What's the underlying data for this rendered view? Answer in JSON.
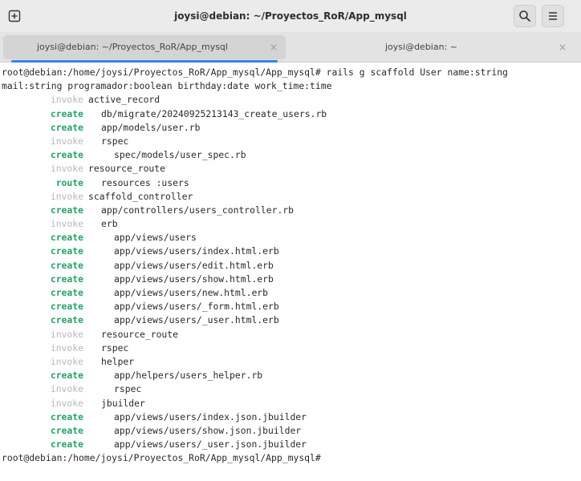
{
  "window": {
    "title": "joysi@debian: ~/Proyectos_RoR/App_mysql"
  },
  "colors": {
    "accent": "#3584e4",
    "create": "#26a269",
    "invoke": "#b8b8b8"
  },
  "tabs": [
    {
      "label": "joysi@debian: ~/Proyectos_RoR/App_mysql",
      "close": "×",
      "active": true
    },
    {
      "label": "joysi@debian: ~",
      "close": "×",
      "active": false
    }
  ],
  "terminal": {
    "command_lines": [
      "root@debian:/home/joysi/Proyectos_RoR/App_mysql/App_mysql# rails g scaffold User name:string",
      "mail:string programador:boolean birthday:date work_time:time"
    ],
    "output": [
      {
        "action": "invoke",
        "path": "active_record",
        "indent": 0
      },
      {
        "action": "create",
        "path": "db/migrate/20240925213143_create_users.rb",
        "indent": 1
      },
      {
        "action": "create",
        "path": "app/models/user.rb",
        "indent": 1
      },
      {
        "action": "invoke",
        "path": "rspec",
        "indent": 1
      },
      {
        "action": "create",
        "path": "spec/models/user_spec.rb",
        "indent": 2
      },
      {
        "action": "invoke",
        "path": "resource_route",
        "indent": 0
      },
      {
        "action": "route",
        "path": "resources :users",
        "indent": 1
      },
      {
        "action": "invoke",
        "path": "scaffold_controller",
        "indent": 0
      },
      {
        "action": "create",
        "path": "app/controllers/users_controller.rb",
        "indent": 1
      },
      {
        "action": "invoke",
        "path": "erb",
        "indent": 1
      },
      {
        "action": "create",
        "path": "app/views/users",
        "indent": 2
      },
      {
        "action": "create",
        "path": "app/views/users/index.html.erb",
        "indent": 2
      },
      {
        "action": "create",
        "path": "app/views/users/edit.html.erb",
        "indent": 2
      },
      {
        "action": "create",
        "path": "app/views/users/show.html.erb",
        "indent": 2
      },
      {
        "action": "create",
        "path": "app/views/users/new.html.erb",
        "indent": 2
      },
      {
        "action": "create",
        "path": "app/views/users/_form.html.erb",
        "indent": 2
      },
      {
        "action": "create",
        "path": "app/views/users/_user.html.erb",
        "indent": 2
      },
      {
        "action": "invoke",
        "path": "resource_route",
        "indent": 1
      },
      {
        "action": "invoke",
        "path": "rspec",
        "indent": 1
      },
      {
        "action": "invoke",
        "path": "helper",
        "indent": 1
      },
      {
        "action": "create",
        "path": "app/helpers/users_helper.rb",
        "indent": 2
      },
      {
        "action": "invoke",
        "path": "rspec",
        "indent": 2
      },
      {
        "action": "invoke",
        "path": "jbuilder",
        "indent": 1
      },
      {
        "action": "create",
        "path": "app/views/users/index.json.jbuilder",
        "indent": 2
      },
      {
        "action": "create",
        "path": "app/views/users/show.json.jbuilder",
        "indent": 2
      },
      {
        "action": "create",
        "path": "app/views/users/_user.json.jbuilder",
        "indent": 2
      }
    ],
    "final_prompt": "root@debian:/home/joysi/Proyectos_RoR/App_mysql/App_mysql#"
  }
}
